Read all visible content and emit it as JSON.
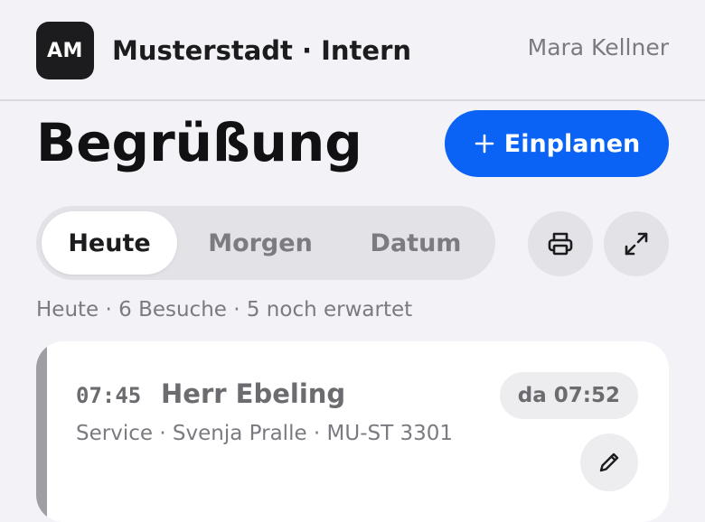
{
  "header": {
    "avatar_initials": "AM",
    "org_title": "Musterstadt · Intern",
    "user_name": "Mara Kellner"
  },
  "page": {
    "title": "Begrüßung",
    "primary_action_label": "Einplanen",
    "primary_action_icon": "plus-icon"
  },
  "tabs": [
    {
      "label": "Heute",
      "active": true
    },
    {
      "label": "Morgen",
      "active": false
    },
    {
      "label": "Datum",
      "active": false
    }
  ],
  "toolbar": {
    "print_icon": "printer-icon",
    "expand_icon": "expand-icon"
  },
  "summary": "Heute · 6 Besuche · 5 noch erwartet",
  "visits": [
    {
      "time": "07:45",
      "name": "Herr Ebeling",
      "meta": "Service · Svenja Pralle · MU-ST 3301",
      "status": "da 07:52",
      "edit_icon": "pencil-icon"
    }
  ],
  "colors": {
    "background": "#f2f2f7",
    "accent": "#0a63f5",
    "text_primary": "#1c1c1e",
    "text_secondary": "#7a7a80",
    "card_accent": "#9e9ea3"
  }
}
